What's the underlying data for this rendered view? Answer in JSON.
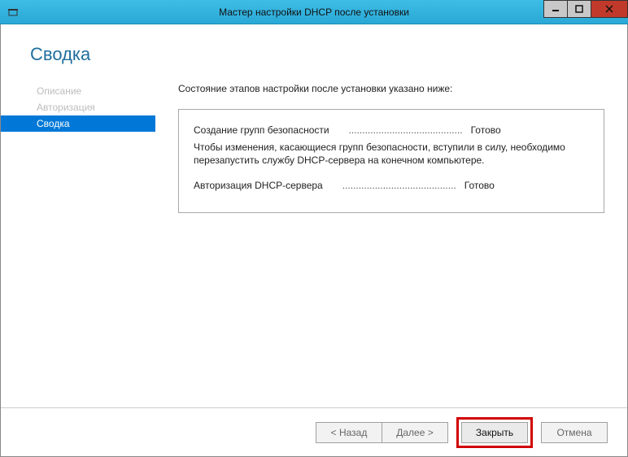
{
  "titlebar": {
    "title": "Мастер настройки DHCP после установки"
  },
  "page": {
    "heading": "Сводка"
  },
  "sidebar": {
    "items": [
      {
        "label": "Описание",
        "selected": false
      },
      {
        "label": "Авторизация",
        "selected": false
      },
      {
        "label": "Сводка",
        "selected": true
      }
    ]
  },
  "main": {
    "intro": "Состояние этапов настройки после установки указано ниже:",
    "results": {
      "line1_label": "Создание групп безопасности",
      "line1_dots": "..........................................",
      "line1_value": "Готово",
      "note": "Чтобы изменения, касающиеся групп безопасности, вступили в силу, необходимо перезапустить службу DHCP-сервера на конечном компьютере.",
      "line2_label": "Авторизация DHCP-сервера",
      "line2_dots": "..........................................",
      "line2_value": "Готово"
    }
  },
  "buttons": {
    "back": "< Назад",
    "next": "Далее >",
    "close": "Закрыть",
    "cancel": "Отмена"
  }
}
